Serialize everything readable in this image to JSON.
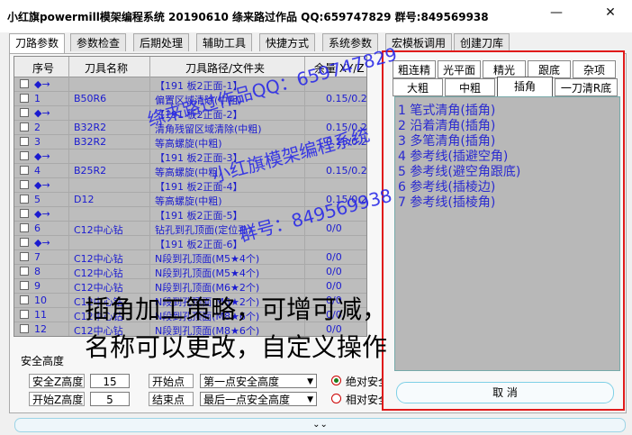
{
  "window": {
    "title": "小红旗powermill模架编程系统 20190610   绦来路过作品 QQ:659747829  群号:849569938",
    "minimize": "—",
    "close": "✕"
  },
  "tabs": [
    {
      "label": "刀路参数"
    },
    {
      "label": "参数检查"
    },
    {
      "label": "后期处理"
    },
    {
      "label": "辅助工具"
    },
    {
      "label": "快捷方式"
    },
    {
      "label": "系统参数"
    },
    {
      "label": "宏模板调用"
    },
    {
      "label": "创建刀库"
    }
  ],
  "grid": {
    "headers": [
      "序号",
      "刀具名称",
      "刀具路径/文件夹",
      "余量 XY/Z"
    ],
    "rows": [
      {
        "marker": "◆→",
        "path": "【191 板2正面-1】"
      },
      {
        "num": "1",
        "tool": "B50R6",
        "path": "偏置区域清除(中粗)",
        "stock": "0.15/0.2"
      },
      {
        "marker": "◆→",
        "path": "【191 板2正面-2】"
      },
      {
        "num": "2",
        "tool": "B32R2",
        "path": "清角残留区域清除(中粗)",
        "stock": "0.15/0.2"
      },
      {
        "num": "3",
        "tool": "B32R2",
        "path": "等高螺旋(中粗)",
        "stock": "0.15/0.2"
      },
      {
        "marker": "◆→",
        "path": "【191 板2正面-3】"
      },
      {
        "num": "4",
        "tool": "B25R2",
        "path": "等高螺旋(中粗)",
        "stock": "0.15/0.2"
      },
      {
        "marker": "◆→",
        "path": "【191 板2正面-4】"
      },
      {
        "num": "5",
        "tool": "D12",
        "path": "等高螺旋(中粗)",
        "stock": "0.15/0.2"
      },
      {
        "marker": "◆→",
        "path": "【191 板2正面-5】"
      },
      {
        "num": "6",
        "tool": "C12中心钻",
        "path": "钻孔到孔顶面(定位孔)",
        "stock": "0/0"
      },
      {
        "marker": "◆→",
        "path": "【191 板2正面-6】"
      },
      {
        "num": "7",
        "tool": "C12中心钻",
        "path": "N段到孔顶面(M5★4个)",
        "stock": "0/0"
      },
      {
        "num": "8",
        "tool": "C12中心钻",
        "path": "N段到孔顶面(M5★4个)",
        "stock": "0/0"
      },
      {
        "num": "9",
        "tool": "C12中心钻",
        "path": "N段到孔顶面(M6★2个)",
        "stock": "0/0"
      },
      {
        "num": "10",
        "tool": "C12中心钻",
        "path": "N段到孔顶面(M6★2个)",
        "stock": "0/0"
      },
      {
        "num": "11",
        "tool": "C12中心钻",
        "path": "N段到孔顶面(M8★6个)",
        "stock": "0/0"
      },
      {
        "num": "12",
        "tool": "C12中心钻",
        "path": "N段到孔顶面(M8★6个)",
        "stock": "0/0"
      }
    ]
  },
  "safety": {
    "section_title": "安全高度",
    "safe_z_label": "安全Z高度",
    "safe_z_value": "15",
    "start_z_label": "开始Z高度",
    "start_z_value": "5",
    "start_point_label": "开始点",
    "start_point_value": "第一点安全高度",
    "end_point_label": "结束点",
    "end_point_value": "最后一点安全高度",
    "absolute_label": "绝对安全",
    "relative_label": "相对安全"
  },
  "right_panel": {
    "tabs_row1": [
      "粗连精",
      "光平面",
      "精光",
      "跟底",
      "杂项"
    ],
    "tabs_row2": [
      "大粗",
      "中粗",
      "插角",
      "一刀清R底"
    ],
    "active_tab": "插角",
    "items": [
      "1  笔式清角(插角)",
      "2  沿着清角(插角)",
      "3  多笔清角(插角)",
      "4  参考线(插避空角)",
      "5  参考线(避空角跟底)",
      "6  参考线(插棱边)",
      "7  参考线(插棱角)"
    ],
    "cancel_label": "取 消"
  },
  "watermark": {
    "line1": "绦来路过作品QQ：659747829",
    "line2": "小红旗模架编程系统",
    "line3": "群号：849569938"
  },
  "overlay": {
    "line1": "插角加工策略，可增可减，",
    "line2": "名称可以更改，自定义操作"
  },
  "bottom_bar": {
    "label": "⌄⌄"
  }
}
